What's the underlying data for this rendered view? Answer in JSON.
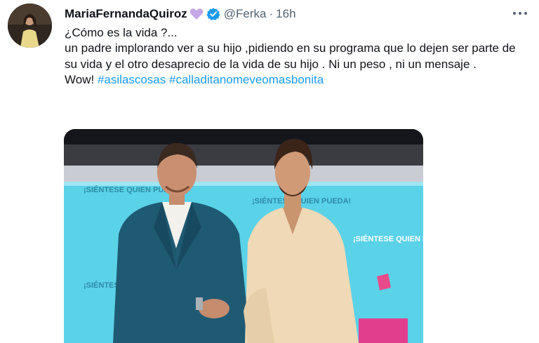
{
  "tweet": {
    "author": {
      "display_name": "MariaFernandaQuiroz",
      "handle": "@Ferka",
      "verified": true,
      "name_emoji_icon": "purple-heart-icon"
    },
    "separator": "·",
    "time": "16h",
    "more_icon": "more-horizontal-icon",
    "text_lines": [
      "¿Cómo es la vida ?...",
      "un padre implorando ver a su hijo ,pidiendo en su programa que lo dejen ser parte de su vida y el otro desaprecio de la vida de su hijo . Ni un peso , ni un mensaje ."
    ],
    "last_line": {
      "prefix": "Wow!",
      "hashtags": [
        "#asilascosas",
        "#calladitanomeveomasbonita"
      ]
    },
    "media": {
      "signs": [
        "¡SIÉNTESE QUIEN PUEDA!",
        "¡SIÉNTESE QUIEN PUEDA!",
        "¡SIÉNTESE QUIEN P",
        "¡SIÉNTESE"
      ]
    }
  },
  "colors": {
    "text": "#0f1419",
    "muted": "#536471",
    "link": "#1d9bf0",
    "verified": "#1d9bf0",
    "heart": "#c4a8e8",
    "studio_cyan": "#5ad2e8",
    "suit_teal": "#1f5a73",
    "shirt_cream": "#efd9b6"
  }
}
